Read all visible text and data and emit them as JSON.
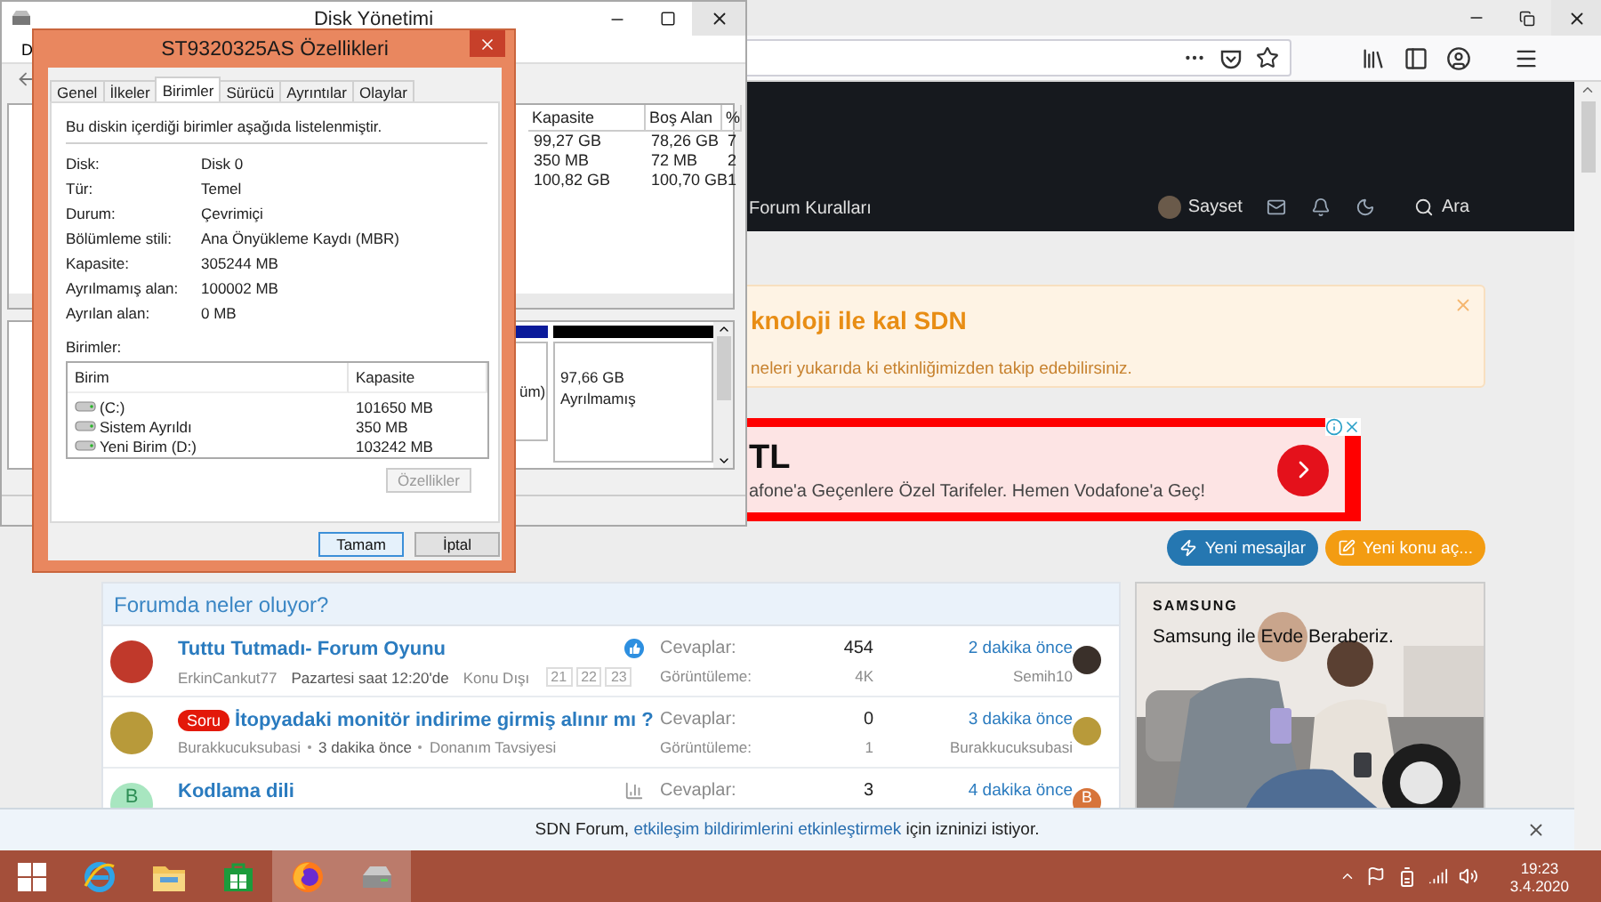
{
  "browser": {
    "nav": [
      {
        "label": "Forum Kuralları"
      }
    ],
    "user": "Sayset",
    "search": "Ara",
    "notice": {
      "title": "knoloji ile kal SDN",
      "text": "neleri yukarıda ki etkinliğimizden takip edebilirsiniz."
    },
    "ad": {
      "headline": "TL",
      "text": "afone'a Geçenlere Özel Tarifeler. Hemen Vodafone'a Geç!"
    },
    "actions": [
      {
        "label": "Yeni mesajlar",
        "kind": "messages",
        "color": "#2577b1"
      },
      {
        "label": "Yeni konu aç...",
        "kind": "new",
        "color": "#f39c12"
      }
    ],
    "feed": {
      "title": "Forumda neler oluyor?",
      "threads": [
        {
          "avatar": {
            "color": "#c0392b"
          },
          "title": "Tuttu Tutmadı- Forum Oyunu",
          "author": "ErkinCankut77",
          "time": "Pazartesi saat 12:20'de",
          "forum": "Konu Dışı",
          "pages": [
            "21",
            "22",
            "23"
          ],
          "kind": "liked",
          "replies_label": "Cevaplar:",
          "replies": "454",
          "views_label": "Görüntüleme:",
          "views": "4K",
          "last_time": "2 dakika önce",
          "last_user": "Semih10",
          "last_avatar": {
            "color": "#3a302a"
          }
        },
        {
          "avatar": {
            "color": "#b89a3a"
          },
          "prefix": "Soru",
          "title": "İtopyadaki monitör indirime girmiş alınır mı ?",
          "author": "Burakkucuksubasi",
          "time": "3 dakika önce",
          "forum": "Donanım Tavsiyesi",
          "replies_label": "Cevaplar:",
          "replies": "0",
          "views_label": "Görüntüleme:",
          "views": "1",
          "last_time": "3 dakika önce",
          "last_user": "Burakkucuksubasi",
          "last_avatar": {
            "color": "#b89a3a"
          }
        },
        {
          "avatar": {
            "color": "#a8e6c0",
            "letter": "B"
          },
          "title": "Kodlama dili",
          "kind": "stats",
          "replies_label": "Cevaplar:",
          "replies": "3",
          "last_time": "4 dakika önce",
          "last_avatar": {
            "color": "#d7743a",
            "letter": "B"
          }
        }
      ]
    },
    "side_ad": {
      "kind": "picture",
      "brand": "SAMSUNG",
      "slogan": "Samsung ile Evde Beraberiz."
    },
    "permission": {
      "before": "SDN Forum,",
      "link": "etkileşim bildirimlerini etkinleştirmek",
      "after": "için izninizi istiyor."
    }
  },
  "disk_window": {
    "title": "Disk Yönetimi",
    "menu_letter": "D",
    "columns": [
      "Kapasite",
      "Boş Alan",
      "%"
    ],
    "rows": [
      [
        "99,27 GB",
        "78,26 GB",
        "7"
      ],
      [
        "350 MB",
        "72 MB",
        "2"
      ],
      [
        "100,82 GB",
        "100,70 GB",
        "1"
      ]
    ],
    "map": {
      "cut_label": "üm)",
      "size": "97,66 GB",
      "status": "Ayrılmamış"
    }
  },
  "dialog": {
    "title": "ST9320325AS Özellikleri",
    "tabs": [
      {
        "label": "Genel",
        "selected": false
      },
      {
        "label": "İlkeler",
        "selected": false
      },
      {
        "label": "Birimler",
        "selected": true
      },
      {
        "label": "Sürücü",
        "selected": false
      },
      {
        "label": "Ayrıntılar",
        "selected": false
      },
      {
        "label": "Olaylar",
        "selected": false
      }
    ],
    "intro": "Bu diskin içerdiği birimler aşağıda listelenmiştir.",
    "fields": [
      {
        "label": "Disk:",
        "value": "Disk 0"
      },
      {
        "label": "Tür:",
        "value": "Temel"
      },
      {
        "label": "Durum:",
        "value": "Çevrimiçi"
      },
      {
        "label": "Bölümleme stili:",
        "value": "Ana Önyükleme Kaydı (MBR)"
      },
      {
        "label": "Kapasite:",
        "value": "305244 MB"
      },
      {
        "label": "Ayrılmamış alan:",
        "value": "100002 MB"
      },
      {
        "label": "Ayrılan alan:",
        "value": "0 MB"
      }
    ],
    "volumes_label": "Birimler:",
    "volume_columns": [
      "Birim",
      "Kapasite"
    ],
    "volumes": [
      {
        "name": "(C:)",
        "size": "101650 MB"
      },
      {
        "name": "Sistem Ayrıldı",
        "size": "350 MB"
      },
      {
        "name": "Yeni Birim (D:)",
        "size": "103242 MB"
      }
    ],
    "properties_button": {
      "label": "Özellikler",
      "disabled": true
    },
    "buttons": [
      {
        "label": "Tamam",
        "default": true
      },
      {
        "label": "İptal",
        "default": false
      }
    ]
  },
  "taskbar": {
    "apps": [
      {
        "kind": "ie",
        "active": false
      },
      {
        "kind": "explorer",
        "active": false
      },
      {
        "kind": "store",
        "active": false
      },
      {
        "kind": "firefox",
        "active": true
      },
      {
        "kind": "disk",
        "active": true
      }
    ],
    "time": "19:23",
    "date": "3.4.2020"
  }
}
